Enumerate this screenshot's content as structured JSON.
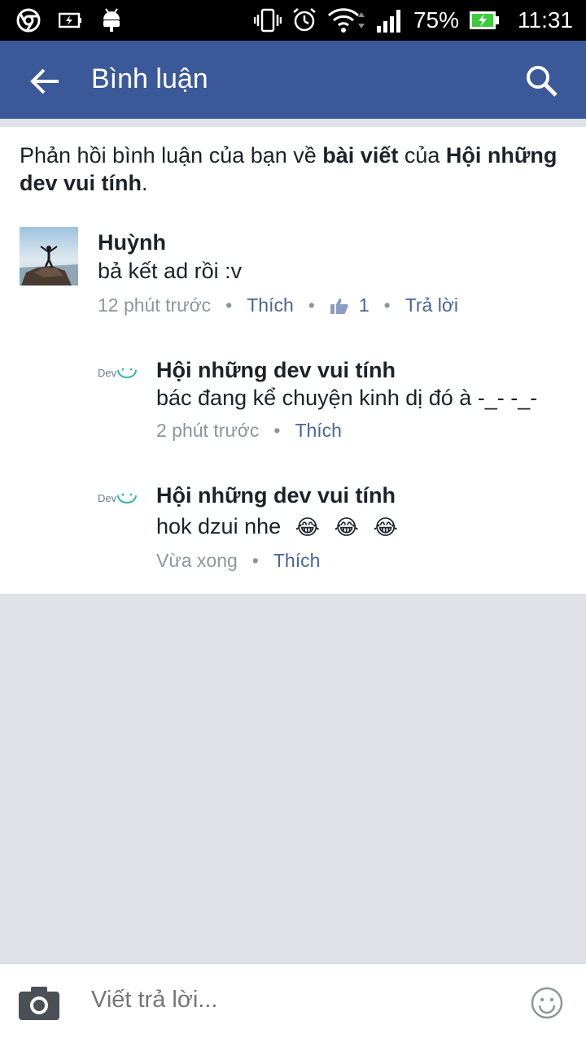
{
  "status_bar": {
    "battery": "75%",
    "time": "11:31",
    "icons": [
      "chrome-icon",
      "battery-saver-icon",
      "android-icon",
      "vibrate-icon",
      "alarm-icon",
      "wifi-icon",
      "signal-icon",
      "battery-charging-icon"
    ]
  },
  "app_bar": {
    "title": "Bình luận",
    "back_icon": "arrow-left-icon",
    "search_icon": "search-icon",
    "color": "#3b5998"
  },
  "header": {
    "part1": "Phản hồi bình luận của bạn về ",
    "bold1": "bài viết",
    "part2": " của ",
    "bold2": "Hội những dev vui tính",
    "part3": "."
  },
  "comments": [
    {
      "name": "Huỳnh",
      "text": "bả kết ad rồi :v",
      "time": "12 phút trước",
      "like_label": "Thích",
      "like_count": "1",
      "reply_label": "Trả lời"
    },
    {
      "name": "Hội những dev vui tính",
      "avatar_text": "Dev",
      "text": "bác đang kể chuyện kinh dị đó à -_- -_-",
      "time": "2 phút trước",
      "like_label": "Thích"
    },
    {
      "name": "Hội những dev vui tính",
      "avatar_text": "Dev",
      "text": "hok dzui nhe",
      "emojis": [
        "😂",
        "😂",
        "😂"
      ],
      "time": "Vừa xong",
      "like_label": "Thích"
    }
  ],
  "composer": {
    "placeholder": "Viết trả lời...",
    "camera_icon": "camera-icon",
    "emoji_icon": "smiley-icon"
  },
  "colors": {
    "accent": "#3b5998",
    "link": "#4b6498",
    "muted": "#90949c",
    "background": "#dfe1e6"
  }
}
